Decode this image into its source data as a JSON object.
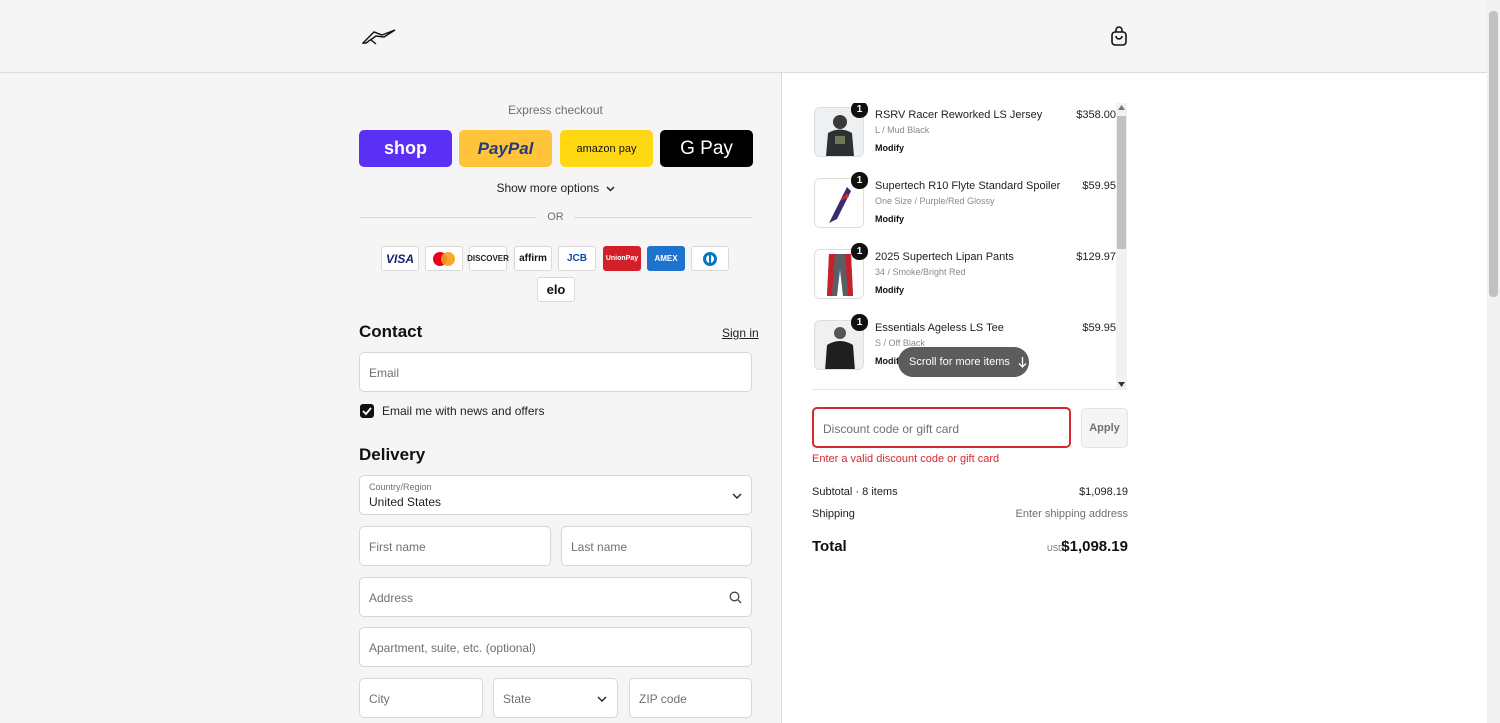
{
  "header": {
    "logo_icon": "alpinestars-logo",
    "cart_icon": "shopping-bag-icon"
  },
  "express": {
    "title": "Express checkout",
    "buttons": [
      {
        "label": "shop"
      },
      {
        "label": "PayPal"
      },
      {
        "label": "amazon pay"
      },
      {
        "label": "G Pay"
      }
    ],
    "more_options": "Show more options",
    "or_label": "OR"
  },
  "cards": [
    "VISA",
    "MC",
    "DISCOVER",
    "affirm",
    "JCB",
    "UnionPay",
    "AMEX",
    "Diners",
    "elo"
  ],
  "contact": {
    "title": "Contact",
    "sign_in": "Sign in",
    "email_placeholder": "Email",
    "newsletter_label": "Email me with news and offers"
  },
  "delivery": {
    "title": "Delivery",
    "country_label": "Country/Region",
    "country_value": "United States",
    "first_name": "First name",
    "last_name": "Last name",
    "address": "Address",
    "apartment": "Apartment, suite, etc. (optional)",
    "city": "City",
    "state": "State",
    "zip": "ZIP code"
  },
  "order": {
    "items": [
      {
        "qty": "1",
        "name": "RSRV Racer Reworked LS Jersey",
        "variant": "L / Mud Black",
        "modify": "Modify",
        "price": "$358.00"
      },
      {
        "qty": "1",
        "name": "Supertech R10 Flyte Standard Spoiler",
        "variant": "One Size / Purple/Red Glossy",
        "modify": "Modify",
        "price": "$59.95"
      },
      {
        "qty": "1",
        "name": "2025 Supertech Lipan Pants",
        "variant": "34 / Smoke/Bright Red",
        "modify": "Modify",
        "price": "$129.97"
      },
      {
        "qty": "1",
        "name": "Essentials Ageless LS Tee",
        "variant": "S / Off Black",
        "modify": "Modify",
        "price": "$59.95"
      }
    ],
    "scroll_hint": "Scroll for more items",
    "discount_placeholder": "Discount code or gift card",
    "apply_label": "Apply",
    "discount_error": "Enter a valid discount code or gift card",
    "subtotal_label": "Subtotal · 8 items",
    "subtotal_value": "$1,098.19",
    "shipping_label": "Shipping",
    "shipping_value": "Enter shipping address",
    "total_label": "Total",
    "currency": "USD",
    "total_value": "$1,098.19"
  },
  "colors": {
    "accent_error": "#d7282f",
    "shop_purple": "#5a31f4",
    "paypal_yellow": "#ffc439",
    "amazon_yellow": "#ffd814"
  }
}
